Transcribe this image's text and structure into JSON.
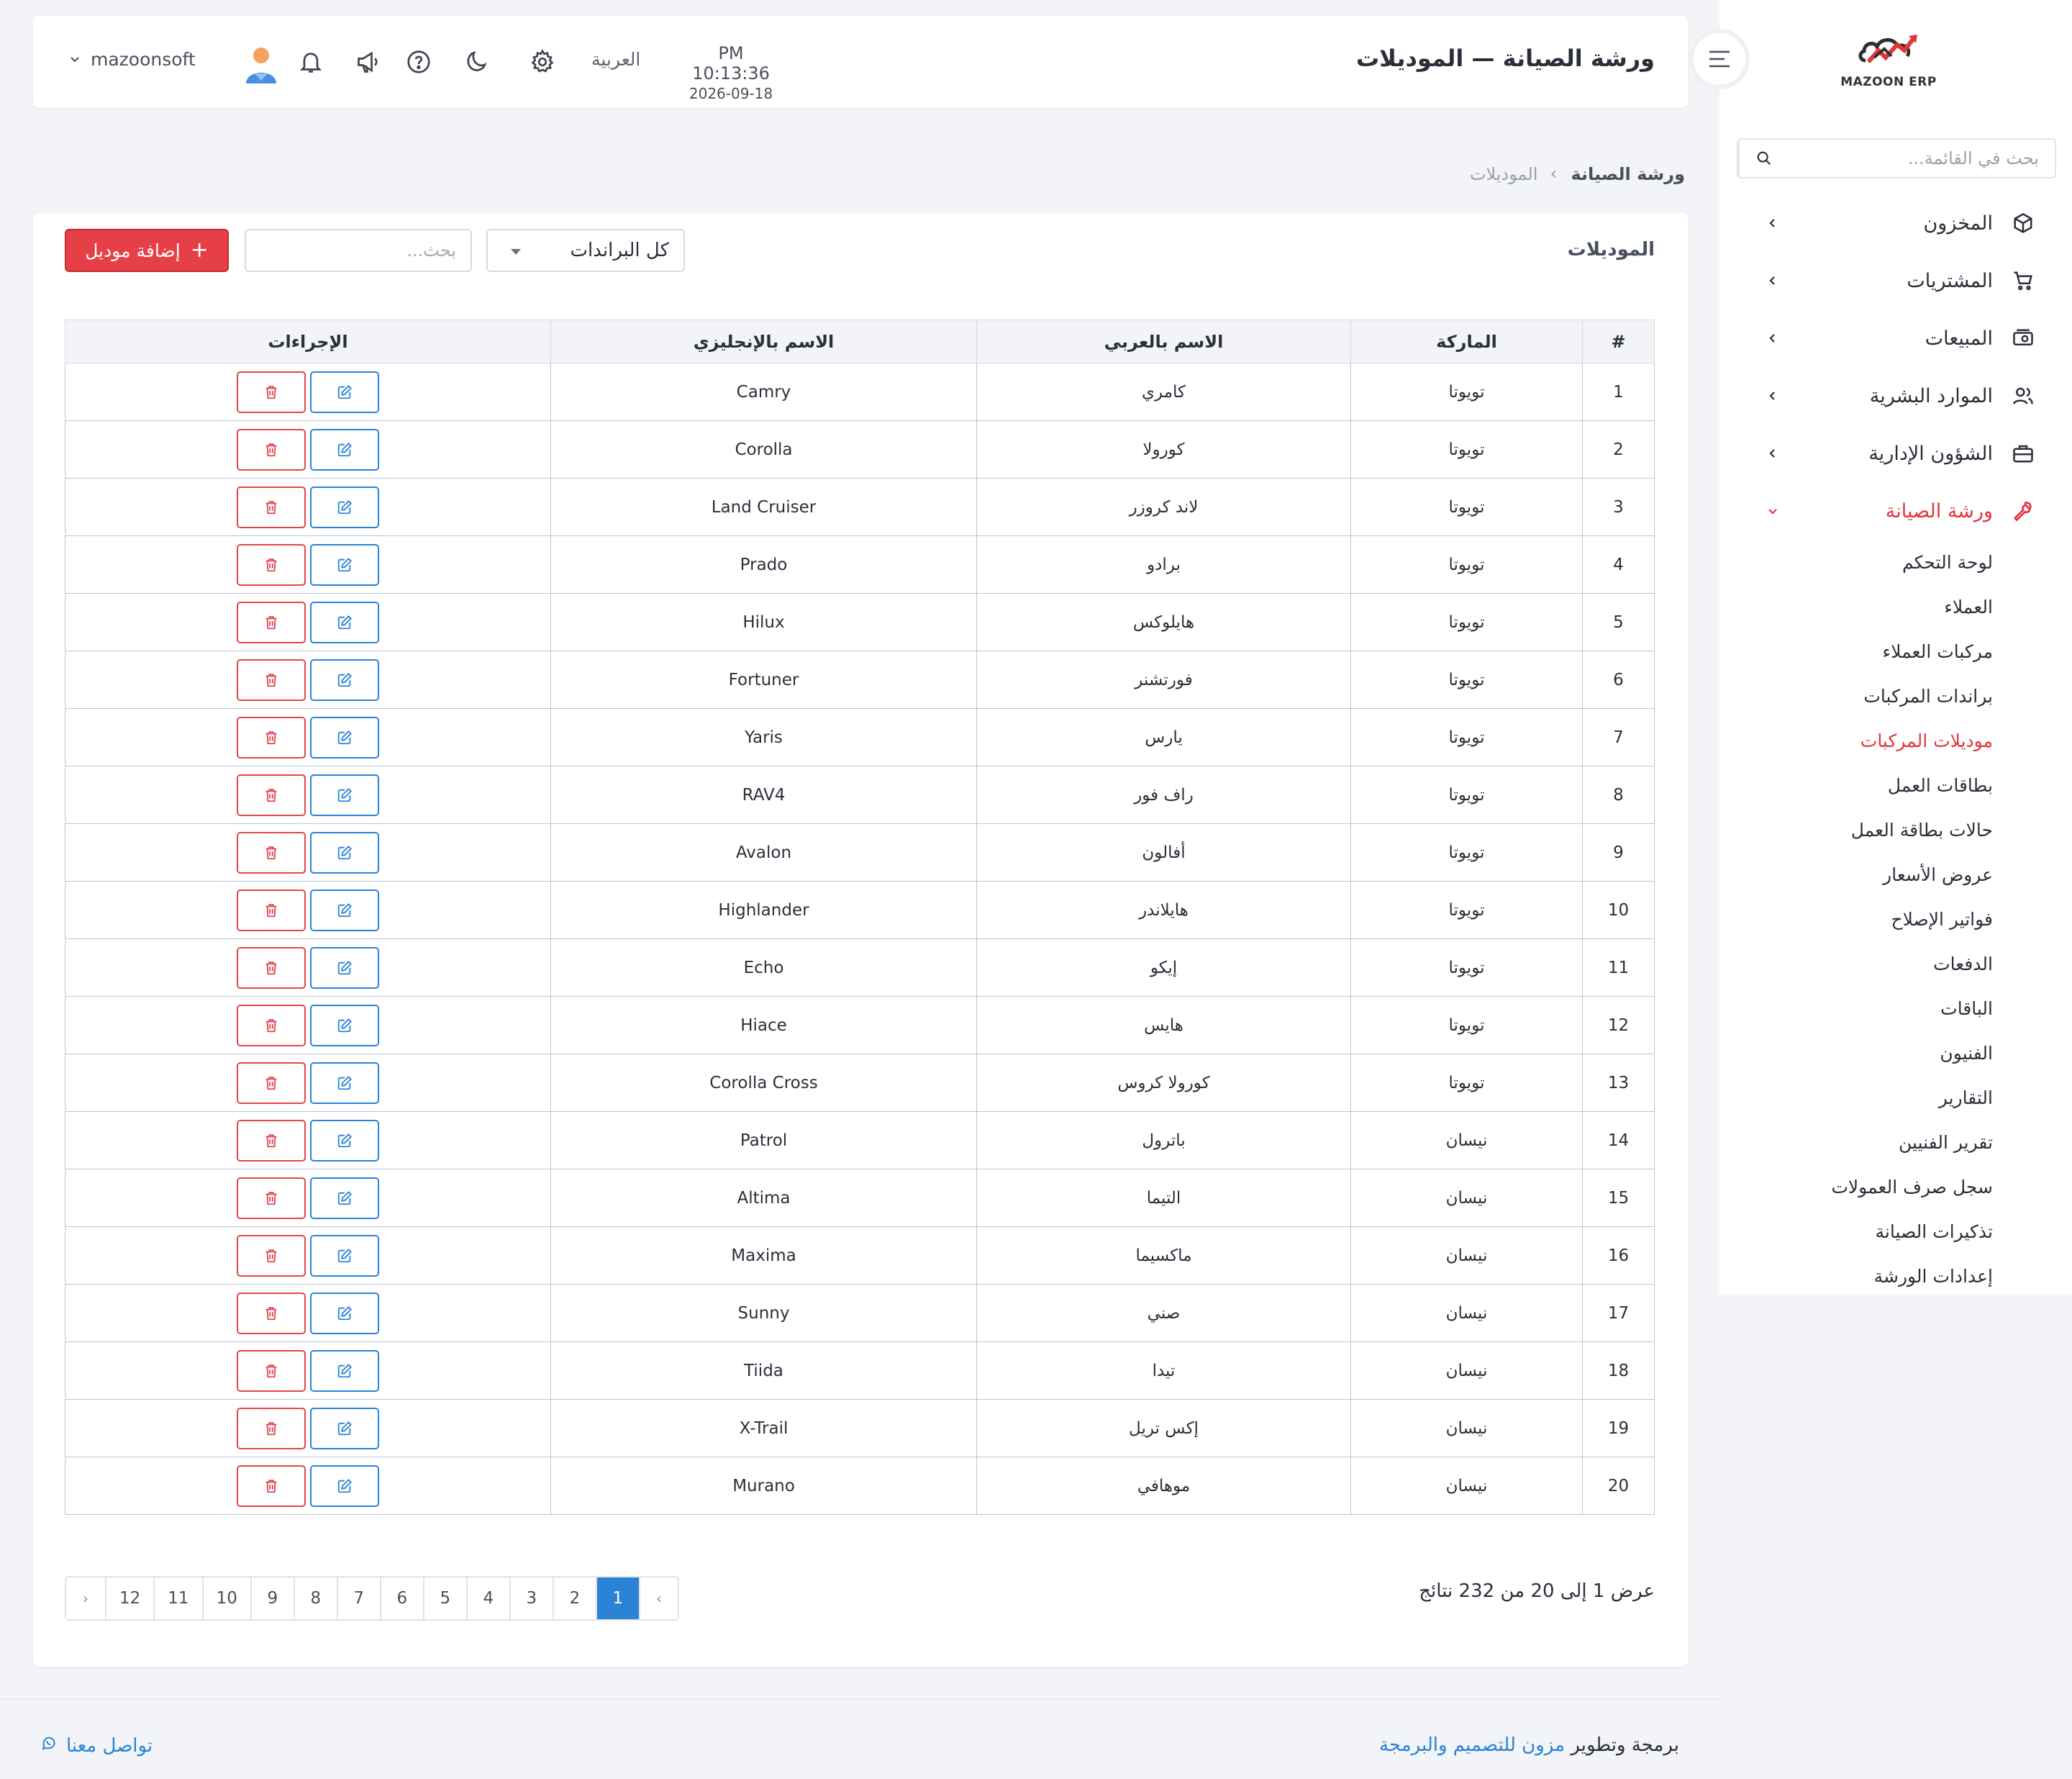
{
  "sidebar": {
    "logo_text": "MAZOON ERP",
    "search_placeholder": "بحث في القائمة...",
    "menu": [
      {
        "label": "المخزون",
        "icon": "box-icon"
      },
      {
        "label": "المشتريات",
        "icon": "cart-icon"
      },
      {
        "label": "المبيعات",
        "icon": "cash-icon"
      },
      {
        "label": "الموارد البشرية",
        "icon": "users-icon"
      },
      {
        "label": "الشؤون الإدارية",
        "icon": "briefcase-icon"
      },
      {
        "label": "ورشة الصيانة",
        "icon": "wrench-icon"
      }
    ],
    "submenu": [
      "لوحة التحكم",
      "العملاء",
      "مركبات العملاء",
      "براندات المركبات",
      "موديلات المركبات",
      "بطاقات العمل",
      "حالات بطاقة العمل",
      "عروض الأسعار",
      "فواتير الإصلاح",
      "الدفعات",
      "الباقات",
      "الفنيون",
      "التقارير",
      "تقرير الفنيين",
      "سجل صرف العمولات",
      "تذكيرات الصيانة",
      "إعدادات الورشة"
    ],
    "active_submenu": "موديلات المركبات"
  },
  "header": {
    "title": "ورشة الصيانة — الموديلات",
    "time": "PM 10:13:36",
    "date": "2026-09-18",
    "language": "العربية",
    "username": "mazoonsoft"
  },
  "breadcrumb": {
    "root": "ورشة الصيانة",
    "current": "الموديلات"
  },
  "card": {
    "title": "الموديلات",
    "brand_filter": "كل البراندات",
    "search_placeholder": "بحث...",
    "add_button": "إضافة موديل"
  },
  "table": {
    "headers": [
      "#",
      "الماركة",
      "الاسم بالعربي",
      "الاسم بالإنجليزي",
      "الإجراءات"
    ],
    "rows": [
      {
        "num": "1",
        "brand": "تويوتا",
        "ar": "كامري",
        "en": "Camry"
      },
      {
        "num": "2",
        "brand": "تويوتا",
        "ar": "كورولا",
        "en": "Corolla"
      },
      {
        "num": "3",
        "brand": "تويوتا",
        "ar": "لاند كروزر",
        "en": "Land Cruiser"
      },
      {
        "num": "4",
        "brand": "تويوتا",
        "ar": "برادو",
        "en": "Prado"
      },
      {
        "num": "5",
        "brand": "تويوتا",
        "ar": "هايلوكس",
        "en": "Hilux"
      },
      {
        "num": "6",
        "brand": "تويوتا",
        "ar": "فورتشنر",
        "en": "Fortuner"
      },
      {
        "num": "7",
        "brand": "تويوتا",
        "ar": "يارس",
        "en": "Yaris"
      },
      {
        "num": "8",
        "brand": "تويوتا",
        "ar": "راف فور",
        "en": "RAV4"
      },
      {
        "num": "9",
        "brand": "تويوتا",
        "ar": "أفالون",
        "en": "Avalon"
      },
      {
        "num": "10",
        "brand": "تويوتا",
        "ar": "هايلاندر",
        "en": "Highlander"
      },
      {
        "num": "11",
        "brand": "تويوتا",
        "ar": "إيكو",
        "en": "Echo"
      },
      {
        "num": "12",
        "brand": "تويوتا",
        "ar": "هايس",
        "en": "Hiace"
      },
      {
        "num": "13",
        "brand": "تويوتا",
        "ar": "كورولا كروس",
        "en": "Corolla Cross"
      },
      {
        "num": "14",
        "brand": "نيسان",
        "ar": "باترول",
        "en": "Patrol"
      },
      {
        "num": "15",
        "brand": "نيسان",
        "ar": "التيما",
        "en": "Altima"
      },
      {
        "num": "16",
        "brand": "نيسان",
        "ar": "ماكسيما",
        "en": "Maxima"
      },
      {
        "num": "17",
        "brand": "نيسان",
        "ar": "صني",
        "en": "Sunny"
      },
      {
        "num": "18",
        "brand": "نيسان",
        "ar": "تيدا",
        "en": "Tiida"
      },
      {
        "num": "19",
        "brand": "نيسان",
        "ar": "إكس تريل",
        "en": "X-Trail"
      },
      {
        "num": "20",
        "brand": "نيسان",
        "ar": "موهافي",
        "en": "Murano"
      }
    ]
  },
  "pagination": {
    "summary": "عرض 1 إلى 20 من 232 نتائج",
    "prev": "‹",
    "next": "›",
    "pages": [
      "1",
      "2",
      "3",
      "4",
      "5",
      "6",
      "7",
      "8",
      "9",
      "10",
      "11",
      "12"
    ],
    "current": "1"
  },
  "footer": {
    "credit_prefix": "برمجة وتطوير",
    "credit_brand": "مزون للتصميم والبرمجة",
    "contact": "تواصل معنا"
  },
  "colors": {
    "accent_red": "#e73f47",
    "accent_blue": "#2b83d6",
    "background": "#f3f4f7"
  }
}
